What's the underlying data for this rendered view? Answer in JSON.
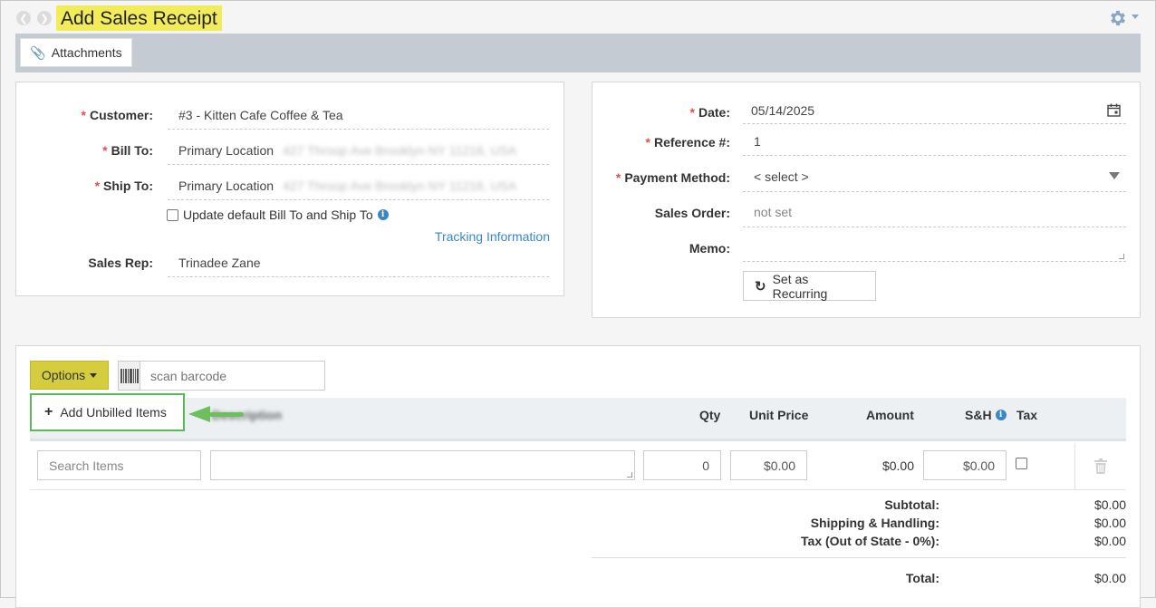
{
  "header": {
    "title": "Add Sales Receipt",
    "back_icon": "back-circle-icon",
    "forward_icon": "forward-circle-icon",
    "settings_icon": "gear-icon"
  },
  "toolbar": {
    "attachments_label": "Attachments"
  },
  "customer_panel": {
    "customer_label": "Customer:",
    "customer_value": "#3 - Kitten Cafe Coffee & Tea",
    "bill_to_label": "Bill To:",
    "bill_to_value": "Primary Location",
    "bill_to_address": "427 Throop Ave Brooklyn NY 11216, USA",
    "ship_to_label": "Ship To:",
    "ship_to_value": "Primary Location",
    "ship_to_address": "427 Throop Ave Brooklyn NY 11216, USA",
    "update_default_label": "Update default Bill To and Ship To",
    "tracking_link": "Tracking Information",
    "sales_rep_label": "Sales Rep:",
    "sales_rep_value": "Trinadee Zane"
  },
  "details_panel": {
    "date_label": "Date:",
    "date_value": "05/14/2025",
    "reference_label": "Reference #:",
    "reference_value": "1",
    "payment_label": "Payment Method:",
    "payment_value": "< select >",
    "sales_order_label": "Sales Order:",
    "sales_order_value": "not set",
    "memo_label": "Memo:",
    "recurring_label": "Set as Recurring"
  },
  "items": {
    "options_label": "Options",
    "barcode_placeholder": "scan barcode",
    "dropdown_item": "Add Unbilled Items",
    "columns": {
      "description": "Description",
      "qty": "Qty",
      "unit_price": "Unit Price",
      "amount": "Amount",
      "sh": "S&H",
      "tax": "Tax"
    },
    "row": {
      "search_placeholder": "Search Items",
      "qty": "0",
      "unit_price": "$0.00",
      "amount": "$0.00",
      "sh": "$0.00"
    }
  },
  "totals": {
    "subtotal_label": "Subtotal:",
    "subtotal_value": "$0.00",
    "shipping_label": "Shipping & Handling:",
    "shipping_value": "$0.00",
    "tax_label": "Tax (Out of State - 0%):",
    "tax_value": "$0.00",
    "total_label": "Total:",
    "total_value": "$0.00"
  },
  "colors": {
    "title_highlight": "#f3ec5a",
    "options_button": "#d5cd3e",
    "callout_green": "#5cb85c",
    "link_blue": "#3a87c8",
    "required_red": "#d9534f"
  }
}
